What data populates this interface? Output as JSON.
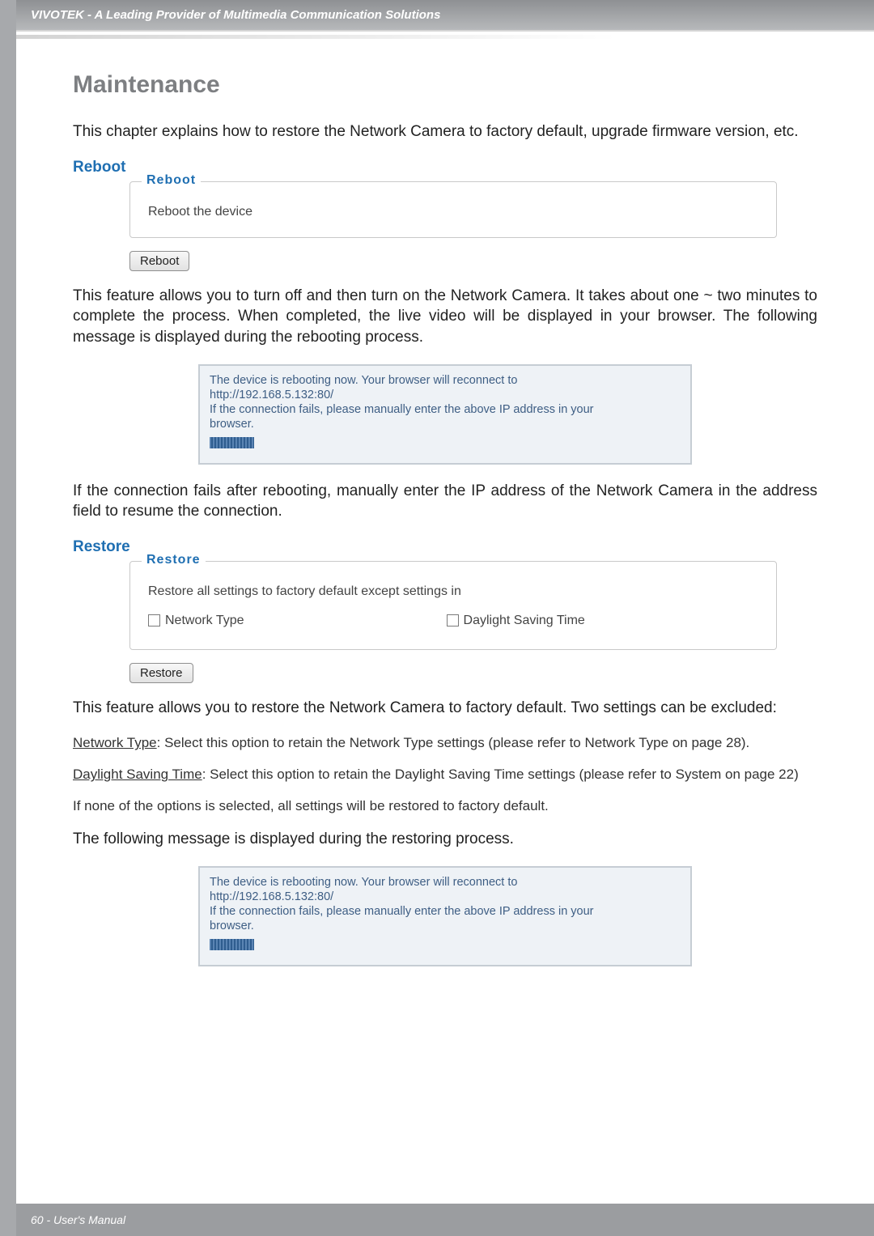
{
  "header": {
    "title": "VIVOTEK - A Leading Provider of Multimedia Communication Solutions"
  },
  "section": {
    "title": "Maintenance",
    "intro": "This chapter explains how to restore the Network Camera to factory default, upgrade firmware version, etc."
  },
  "reboot": {
    "heading": "Reboot",
    "legend": "Reboot",
    "body": "Reboot the device",
    "button": "Reboot",
    "para1": "This feature allows you to turn off and then turn on the Network Camera. It takes about one ~ two minutes to complete the process. When completed, the live video will be displayed in your browser. The following message is displayed during the rebooting process.",
    "msg": {
      "l1": "The device is rebooting now. Your browser will reconnect to",
      "l2": "http://192.168.5.132:80/",
      "l3": "If the connection fails, please manually enter the above IP address in your",
      "l4": "browser."
    },
    "para2": "If the connection fails after rebooting, manually enter the IP address of the Network Camera in the address field to resume the connection."
  },
  "restore": {
    "heading": "Restore",
    "legend": "Restore",
    "body": "Restore all settings to factory default except settings in",
    "cb1": "Network Type",
    "cb2": "Daylight Saving Time",
    "button": "Restore",
    "para1": "This feature allows you to restore the Network Camera to factory default. Two settings can be excluded:",
    "net_u": "Network Type",
    "net_rest": ": Select this option to retain the Network Type settings (please refer to Network Type on page 28).",
    "dst_u": "Daylight Saving Time",
    "dst_rest": ": Select this option to retain the Daylight Saving Time settings (please refer to System on page 22)",
    "para_none": "If none of the options is selected, all settings will be restored to factory default.",
    "para_follow": "The following message is displayed during the restoring process.",
    "msg": {
      "l1": "The device is rebooting now. Your browser will reconnect to",
      "l2": "http://192.168.5.132:80/",
      "l3": "If the connection fails, please manually enter the above IP address in your",
      "l4": "browser."
    }
  },
  "footer": {
    "text": "60 - User's Manual"
  }
}
